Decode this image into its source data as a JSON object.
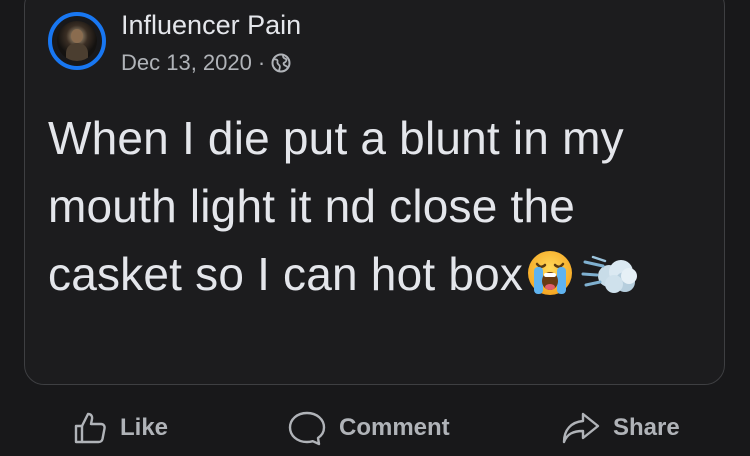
{
  "post": {
    "author": "Influencer Pain",
    "date": "Dec 13, 2020",
    "separator": "·",
    "privacy_icon": "globe-icon",
    "text": "When I die put a blunt in my mouth light it nd close the casket so I can hot box",
    "emojis": [
      "loudly-crying-face-emoji",
      "dashing-away-emoji"
    ]
  },
  "actions": {
    "like_label": "Like",
    "comment_label": "Comment",
    "share_label": "Share"
  },
  "colors": {
    "background": "#18181a",
    "text": "#e4e6eb",
    "secondary_text": "#b0b3b8",
    "avatar_ring": "#1877f2",
    "card_border": "#3e3f42"
  }
}
